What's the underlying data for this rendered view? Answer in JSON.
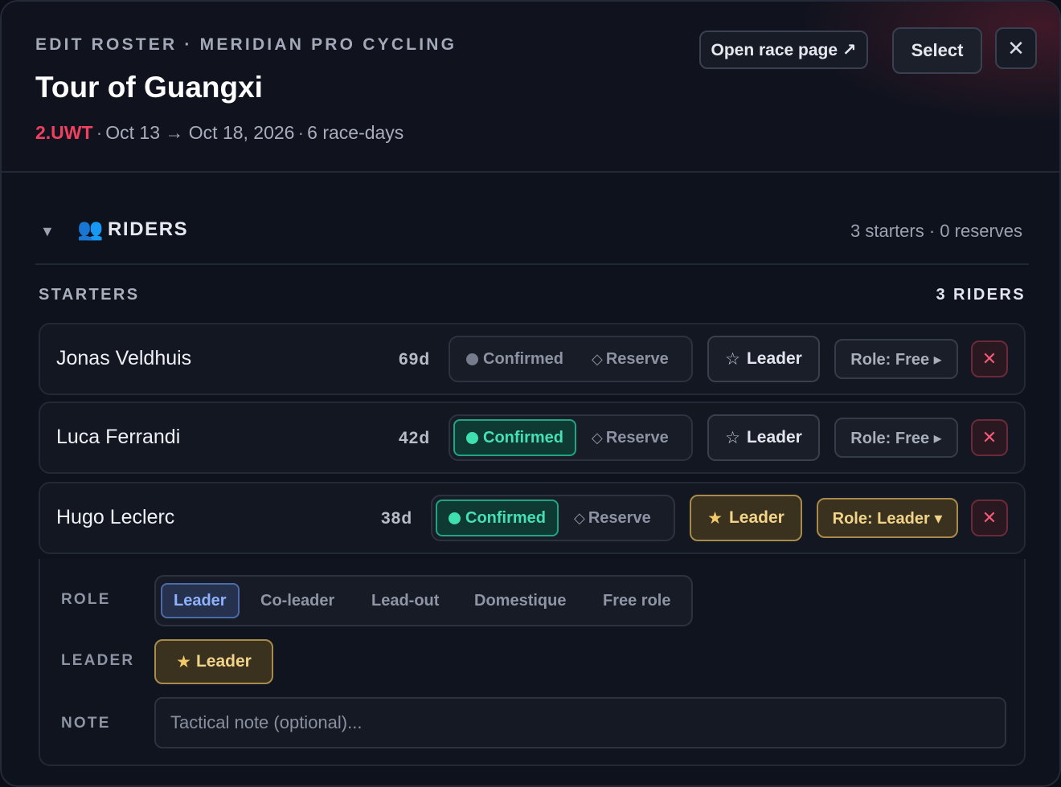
{
  "header": {
    "eyebrow": "EDIT ROSTER · MERIDIAN PRO CYCLING",
    "title": "Tour of Guangxi",
    "category": "2.UWT",
    "dates": "Oct 13 → Oct 18, 2026",
    "race_days": "6 race-days",
    "open_race_page_label": "Open race page ↗",
    "select_label": "Select",
    "close_label": "✕"
  },
  "riders_section": {
    "caret": "▼",
    "icon": "👥",
    "title": "RIDERS",
    "summary": "3 starters · 0 reserves",
    "starters_label": "STARTERS",
    "starters_count": "3 RIDERS"
  },
  "riders": [
    {
      "name": "Jonas Veldhuis",
      "days": "69d",
      "confirmed_label": "Confirmed",
      "reserve_label": "Reserve",
      "confirmed": false,
      "leader_label": "Leader",
      "leader": false,
      "role_label": "Role: Free ▸",
      "remove_label": "✕"
    },
    {
      "name": "Luca Ferrandi",
      "days": "42d",
      "confirmed_label": "Confirmed",
      "reserve_label": "Reserve",
      "confirmed": true,
      "leader_label": "Leader",
      "leader": false,
      "role_label": "Role: Free ▸",
      "remove_label": "✕"
    },
    {
      "name": "Hugo Leclerc",
      "days": "38d",
      "confirmed_label": "Confirmed",
      "reserve_label": "Reserve",
      "confirmed": true,
      "leader_label": "Leader",
      "leader": true,
      "role_label": "Role: Leader ▾",
      "remove_label": "✕"
    }
  ],
  "expanded": {
    "role_label": "ROLE",
    "leader_label": "LEADER",
    "note_label": "NOTE",
    "roles": [
      "Leader",
      "Co-leader",
      "Lead-out",
      "Domestique",
      "Free role"
    ],
    "selected_role": "Leader",
    "leader_toggle_label": "Leader",
    "note_value": "",
    "note_placeholder": "Tactical note (optional)..."
  },
  "colors": {
    "category": "#f0405f",
    "confirmed": "#45e0b4",
    "leader_gold": "#f2d38a",
    "role_selected": "#8fb2ff",
    "remove": "#f15a78"
  }
}
